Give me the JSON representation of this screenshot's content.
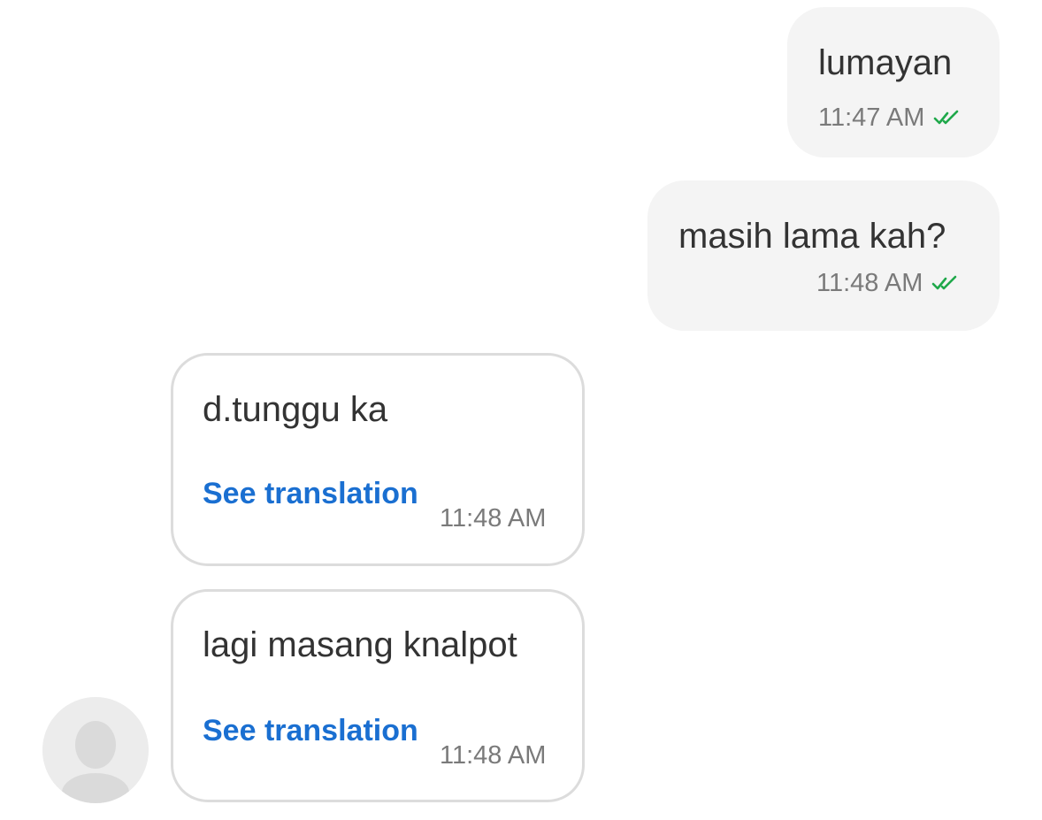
{
  "messages": [
    {
      "direction": "outgoing",
      "text": "lumayan",
      "time": "11:47 AM",
      "status_icon": "double-check-icon"
    },
    {
      "direction": "outgoing",
      "text": "masih lama kah?",
      "time": "11:48 AM",
      "status_icon": "double-check-icon"
    },
    {
      "direction": "incoming",
      "text": "d.tunggu ka",
      "translate_label": "See translation",
      "time": "11:48 AM"
    },
    {
      "direction": "incoming",
      "text": "lagi masang knalpot",
      "translate_label": "See translation",
      "time": "11:48 AM"
    }
  ],
  "colors": {
    "outgoing_bubble": "#f4f4f4",
    "incoming_border": "#dcdcdc",
    "link": "#1a6fd1",
    "read_check": "#1fa84a",
    "timestamp": "#7a7a7a"
  },
  "avatar": {
    "icon": "person-placeholder-icon"
  }
}
